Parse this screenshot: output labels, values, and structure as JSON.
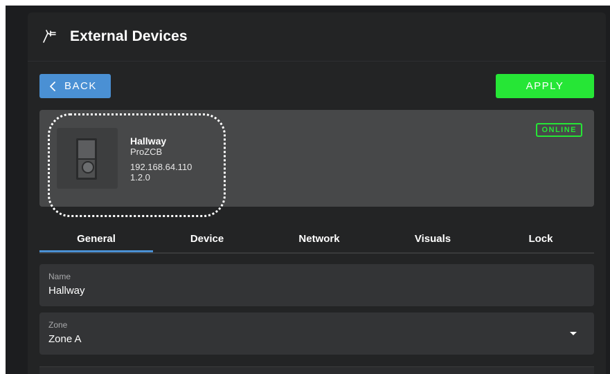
{
  "header": {
    "title": "External Devices",
    "icon": "flag-plug-icon"
  },
  "actions": {
    "back_label": "BACK",
    "apply_label": "APPLY"
  },
  "device": {
    "name": "Hallway",
    "model": "ProZCB",
    "ip": "192.168.64.110",
    "version": "1.2.0",
    "status": "ONLINE"
  },
  "tabs": [
    {
      "label": "General"
    },
    {
      "label": "Device"
    },
    {
      "label": "Network"
    },
    {
      "label": "Visuals"
    },
    {
      "label": "Lock"
    }
  ],
  "active_tab": "General",
  "form": {
    "name": {
      "label": "Name",
      "value": "Hallway"
    },
    "zone": {
      "label": "Zone",
      "value": "Zone A"
    }
  },
  "colors": {
    "accent": "#4a90d4",
    "apply": "#26e636",
    "online": "#26e636",
    "background": "#1c1d1f",
    "panel": "#232425"
  }
}
